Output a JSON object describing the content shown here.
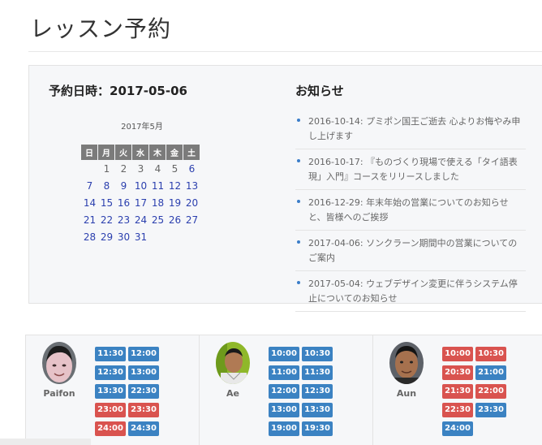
{
  "page": {
    "title": "レッスン予約"
  },
  "reservation": {
    "label": "予約日時：",
    "date": "2017-05-06"
  },
  "calendar": {
    "caption": "2017年5月",
    "weekdays": [
      "日",
      "月",
      "火",
      "水",
      "木",
      "金",
      "土"
    ],
    "weeks": [
      [
        "",
        "1",
        "2",
        "3",
        "4",
        "5",
        "6"
      ],
      [
        "7",
        "8",
        "9",
        "10",
        "11",
        "12",
        "13"
      ],
      [
        "14",
        "15",
        "16",
        "17",
        "18",
        "19",
        "20"
      ],
      [
        "21",
        "22",
        "23",
        "24",
        "25",
        "26",
        "27"
      ],
      [
        "28",
        "29",
        "30",
        "31",
        "",
        "",
        ""
      ]
    ],
    "link_color": "#2b3fae",
    "plain_color": "#666666"
  },
  "news": {
    "heading": "お知らせ",
    "items": [
      {
        "text": "2016-10-14: プミポン国王ご逝去 心よりお悔やみ申し上げます"
      },
      {
        "text": "2016-10-17: 『ものづくり現場で使える「タイ語表現」入門』コースをリリースしました"
      },
      {
        "text": "2016-12-29: 年末年始の営業についてのお知らせと、皆様へのご挨拶"
      },
      {
        "text": "2017-04-06: ソンクラーン期間中の営業についてのご案内"
      },
      {
        "text": "2017-05-04: ウェブデザイン変更に伴うシステム停止についてのお知らせ"
      }
    ]
  },
  "colors": {
    "slot_open": "#3b82c2",
    "slot_taken": "#d9534f",
    "accent": "#3a7dc9"
  },
  "teachers": [
    {
      "name": "Paifon",
      "slots": [
        {
          "time": "11:30",
          "status": "open"
        },
        {
          "time": "12:00",
          "status": "open"
        },
        {
          "time": "12:30",
          "status": "open"
        },
        {
          "time": "13:00",
          "status": "open"
        },
        {
          "time": "13:30",
          "status": "open"
        },
        {
          "time": "22:30",
          "status": "open"
        },
        {
          "time": "23:00",
          "status": "taken"
        },
        {
          "time": "23:30",
          "status": "taken"
        },
        {
          "time": "24:00",
          "status": "taken"
        },
        {
          "time": "24:30",
          "status": "open"
        }
      ]
    },
    {
      "name": "Ae",
      "slots": [
        {
          "time": "10:00",
          "status": "open"
        },
        {
          "time": "10:30",
          "status": "open"
        },
        {
          "time": "11:00",
          "status": "open"
        },
        {
          "time": "11:30",
          "status": "open"
        },
        {
          "time": "12:00",
          "status": "open"
        },
        {
          "time": "12:30",
          "status": "open"
        },
        {
          "time": "13:00",
          "status": "open"
        },
        {
          "time": "13:30",
          "status": "open"
        },
        {
          "time": "19:00",
          "status": "open"
        },
        {
          "time": "19:30",
          "status": "open"
        }
      ]
    },
    {
      "name": "Aun",
      "slots": [
        {
          "time": "10:00",
          "status": "taken"
        },
        {
          "time": "10:30",
          "status": "taken"
        },
        {
          "time": "20:30",
          "status": "taken"
        },
        {
          "time": "21:00",
          "status": "open"
        },
        {
          "time": "21:30",
          "status": "taken"
        },
        {
          "time": "22:00",
          "status": "taken"
        },
        {
          "time": "22:30",
          "status": "taken"
        },
        {
          "time": "23:30",
          "status": "open"
        },
        {
          "time": "24:00",
          "status": "open"
        }
      ]
    }
  ]
}
